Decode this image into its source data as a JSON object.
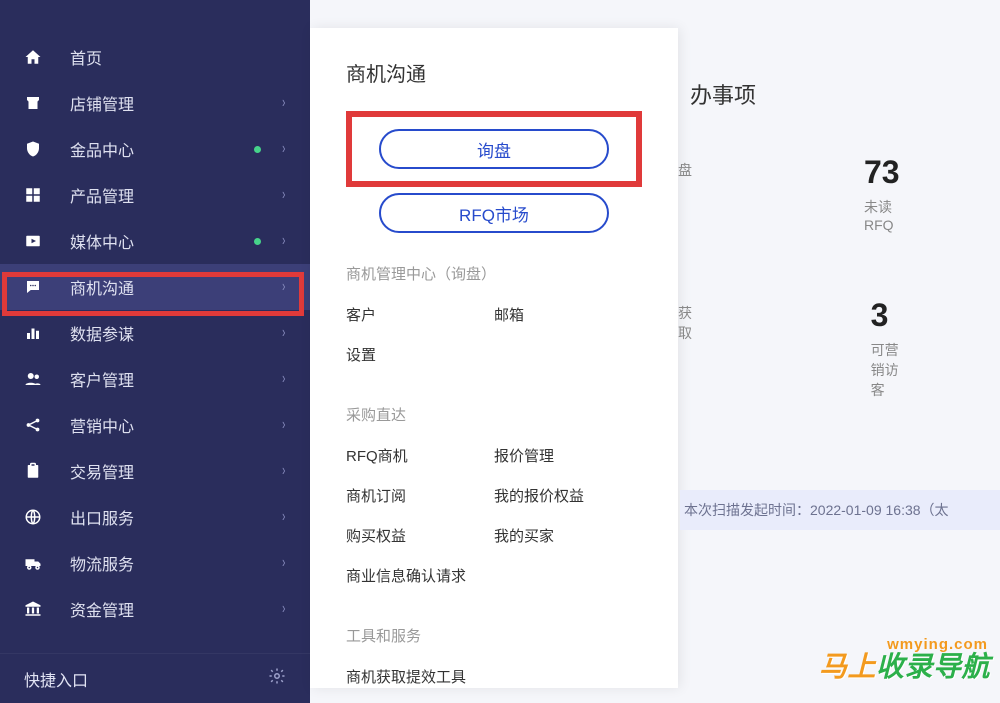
{
  "sidebar": {
    "items": [
      {
        "label": "首页",
        "expandable": false,
        "dot": false
      },
      {
        "label": "店铺管理",
        "expandable": true,
        "dot": false
      },
      {
        "label": "金品中心",
        "expandable": true,
        "dot": true
      },
      {
        "label": "产品管理",
        "expandable": true,
        "dot": false
      },
      {
        "label": "媒体中心",
        "expandable": true,
        "dot": true
      },
      {
        "label": "商机沟通",
        "expandable": true,
        "dot": false
      },
      {
        "label": "数据参谋",
        "expandable": true,
        "dot": false
      },
      {
        "label": "客户管理",
        "expandable": true,
        "dot": false
      },
      {
        "label": "营销中心",
        "expandable": true,
        "dot": false
      },
      {
        "label": "交易管理",
        "expandable": true,
        "dot": false
      },
      {
        "label": "出口服务",
        "expandable": true,
        "dot": false
      },
      {
        "label": "物流服务",
        "expandable": true,
        "dot": false
      },
      {
        "label": "资金管理",
        "expandable": true,
        "dot": false
      }
    ],
    "shortcut_label": "快捷入口"
  },
  "submenu": {
    "title": "商机沟通",
    "pill1": "询盘",
    "pill2": "RFQ市场",
    "section1_title": "商机管理中心（询盘）",
    "section1_links": [
      "客户",
      "邮箱",
      "设置"
    ],
    "section2_title": "采购直达",
    "section2_links": [
      "RFQ商机",
      "报价管理",
      "商机订阅",
      "我的报价权益",
      "购买权益",
      "我的买家",
      "商业信息确认请求"
    ],
    "section3_title": "工具和服务",
    "section3_links": [
      "商机获取提效工具"
    ]
  },
  "right": {
    "todo_title": "办事项",
    "row1": [
      {
        "value": "",
        "label": "盘"
      },
      {
        "value": "73",
        "label": "未读RFQ"
      }
    ],
    "row2": [
      {
        "value": "",
        "label": "获取"
      },
      {
        "value": "3",
        "label": "可营销访客"
      }
    ],
    "scan_text": "本次扫描发起时间：2022-01-09 16:38（太"
  },
  "watermark": {
    "small": "wmying.com",
    "big_a": "马上",
    "big_b": "收录导航"
  }
}
